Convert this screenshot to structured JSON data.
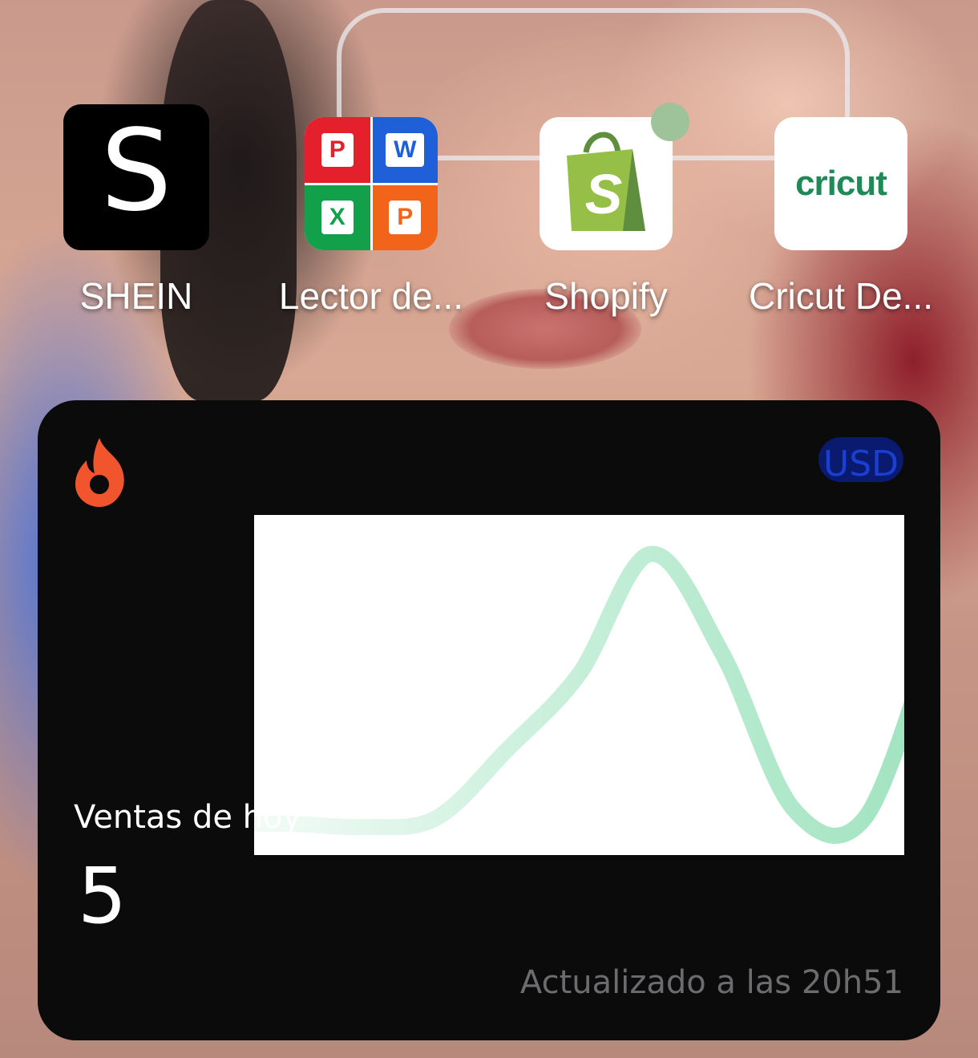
{
  "home_screen": {
    "apps": [
      {
        "label": "SHEIN",
        "icon": "shein-icon"
      },
      {
        "label": "Lector de...",
        "icon": "office-reader-icon"
      },
      {
        "label": "Shopify",
        "icon": "shopify-bag-icon"
      },
      {
        "label": "Cricut De...",
        "icon": "cricut-icon"
      }
    ],
    "shein_glyph": "S",
    "office_tiles": [
      "P",
      "W",
      "X",
      "P"
    ],
    "shopify_glyph": "S",
    "cricut_wordmark": "cricut"
  },
  "widget": {
    "brand_icon": "flame-icon",
    "currency": "USD",
    "sales_label": "Ventas de hoy",
    "sales_value": "5",
    "updated_text": "Actualizado a las 20h51",
    "colors": {
      "background": "#0b0b0c",
      "flame": "#f0552d",
      "line": "#9fe3bf",
      "currency_text": "#1a3fd1",
      "currency_bg": "#0a1a6e",
      "muted_text": "#6c6c6e"
    }
  },
  "chart_data": {
    "type": "line",
    "series": [
      {
        "values": [
          0.05,
          0.05,
          0.04,
          0.07,
          0.3,
          0.55,
          0.95,
          0.62,
          0.1,
          0.07,
          0.7
        ]
      }
    ],
    "ylim": [
      0,
      1
    ],
    "grid": false,
    "axes_visible": false
  }
}
